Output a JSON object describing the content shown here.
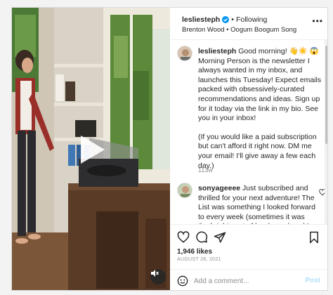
{
  "post": {
    "username": "lesliesteph",
    "follow_status": "Following",
    "audio": "Brenton Wood • Oogum Boogum Song"
  },
  "caption": {
    "username": "lesliesteph",
    "paragraph1": "Good morning! 👋☀️ 😱 Morning Person is the newsletter I always wanted in my inbox, and launches this Tuesday! Expect emails packed with obsessively-curated recommendations and ideas. Sign up for it today via the link in my bio. See you in your inbox!",
    "paragraph2": "(If you would like a paid subscription but can't afford it right now. DM me your email! I'll give away a few each day.)",
    "time": "113w"
  },
  "comment": {
    "username": "sonyageeee",
    "text": "Just subscribed and thrilled for your next adventure! The List was something I looked forward to every week (sometimes it was the bright spot of hard ones) and I"
  },
  "engagement": {
    "likes": "1,946 likes",
    "date": "AUGUST 28, 2021"
  },
  "add_comment": {
    "placeholder": "Add a comment...",
    "post_label": "Post"
  },
  "icons": {
    "verified": "verified-badge-icon",
    "more": "more-options-icon",
    "like": "heart-icon",
    "comment": "comment-icon",
    "share": "share-icon",
    "save": "bookmark-icon",
    "emoji": "emoji-icon",
    "play": "play-icon",
    "mute": "audio-muted-icon"
  },
  "colors": {
    "verified_blue": "#0095f6",
    "post_button_disabled": "#b2dffc",
    "secondary_text": "#8e8e8e"
  }
}
